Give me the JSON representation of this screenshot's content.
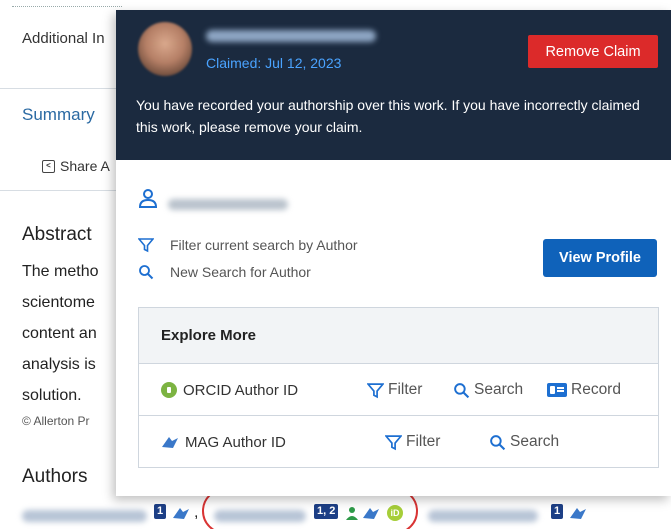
{
  "background": {
    "tab_additional": "Additional In",
    "tab_summary": "Summary",
    "share_label": "Share A",
    "abstract_heading": "Abstract",
    "abstract_lines": [
      "The metho",
      "scientome",
      "content an",
      "analysis is",
      "solution."
    ],
    "copyright": "© Allerton Pr",
    "authors_heading": "Authors",
    "author_badges": [
      "1",
      "1, 2",
      "1"
    ],
    "separator": ","
  },
  "popover": {
    "claimed_date": "Claimed: Jul 12, 2023",
    "remove_claim_label": "Remove Claim",
    "claim_message": "You have recorded your authorship over this work. If you have incorrectly claimed this work, please remove your claim.",
    "filter_label": "Filter current search by Author",
    "new_search_label": "New Search for Author",
    "view_profile_label": "View Profile",
    "explore": {
      "heading": "Explore More",
      "rows": [
        {
          "label": "ORCID Author ID",
          "filter": "Filter",
          "search": "Search",
          "record": "Record"
        },
        {
          "label": "MAG Author ID",
          "filter": "Filter",
          "search": "Search"
        }
      ]
    }
  },
  "colors": {
    "header_bg": "#1b2a3f",
    "claimed_date": "#4aa3ff",
    "remove_button": "#dc2a2a",
    "view_profile_button": "#0f62ba",
    "link_blue": "#1d6fd1",
    "highlight_ring": "#d93434",
    "orcid_green": "#7cb342"
  }
}
